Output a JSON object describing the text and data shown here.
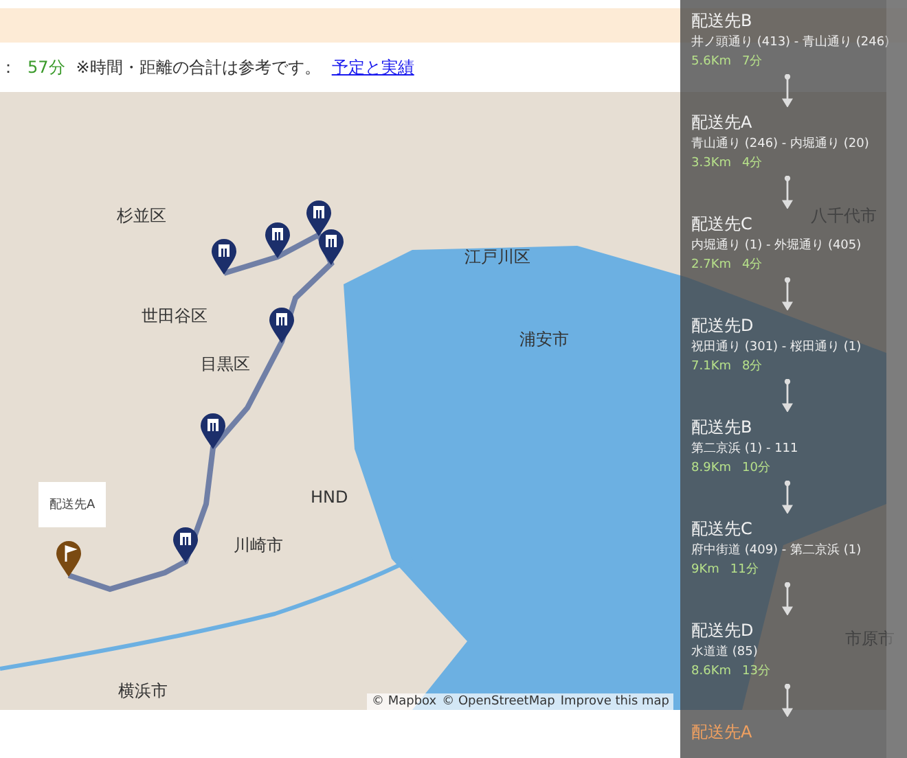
{
  "summary": {
    "prefix": "：",
    "total_time": "57分",
    "note": "※時間・距離の合計は参考です。",
    "link": "予定と実績"
  },
  "map": {
    "place_labels": [
      "杉並区",
      "世田谷区",
      "目黒区",
      "江戸川区",
      "浦安市",
      "川崎市",
      "横浜市",
      "八千代市",
      "市原市",
      "HND"
    ],
    "popup": "配送先A",
    "attribution": [
      "© Mapbox",
      "© OpenStreetMap",
      "Improve this map"
    ]
  },
  "route": [
    {
      "kind": "leg",
      "name": "配送先B",
      "roads": "井ノ頭通り (413) - 青山通り (246)",
      "distance": "5.6Km",
      "time": "7分"
    },
    {
      "kind": "leg",
      "name": "配送先A",
      "roads": "青山通り (246) - 内堀通り (20)",
      "distance": "3.3Km",
      "time": "4分"
    },
    {
      "kind": "leg",
      "name": "配送先C",
      "roads": "内堀通り (1) - 外堀通り (405)",
      "distance": "2.7Km",
      "time": "4分"
    },
    {
      "kind": "leg",
      "name": "配送先D",
      "roads": "祝田通り (301) - 桜田通り (1)",
      "distance": "7.1Km",
      "time": "8分"
    },
    {
      "kind": "leg",
      "name": "配送先B",
      "roads": "第二京浜 (1) - 111",
      "distance": "8.9Km",
      "time": "10分"
    },
    {
      "kind": "leg",
      "name": "配送先C",
      "roads": "府中街道 (409) - 第二京浜 (1)",
      "distance": "9Km",
      "time": "11分"
    },
    {
      "kind": "leg",
      "name": "配送先D",
      "roads": "水道道 (85)",
      "distance": "8.6Km",
      "time": "13分"
    },
    {
      "kind": "end",
      "name": "配送先A"
    }
  ]
}
